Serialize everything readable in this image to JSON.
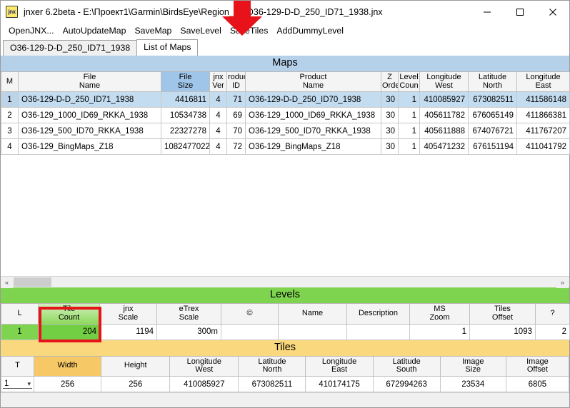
{
  "window": {
    "icon_label": "jnx",
    "title": "jnxer 6.2beta - E:\\Проект1\\Garmin\\BirdsEye\\Region_69\\O36-129-D-D_250_ID71_1938.jnx",
    "minimize_label": "minimize-icon",
    "maximize_label": "maximize-icon",
    "close_label": "close-icon"
  },
  "menu": {
    "items": [
      {
        "label": "OpenJNX..."
      },
      {
        "label": "AutoUpdateMap"
      },
      {
        "label": "SaveMap"
      },
      {
        "label": "SaveLevel"
      },
      {
        "label": "SaveTiles"
      },
      {
        "label": "AddDummyLevel"
      }
    ]
  },
  "tabs": [
    {
      "label": "O36-129-D-D_250_ID71_1938",
      "active": false
    },
    {
      "label": "List of Maps",
      "active": true
    }
  ],
  "maps": {
    "title": "Maps",
    "headers": [
      "M",
      "File\nName",
      "File\nSize",
      "jnx\nVer",
      "roduc\nID",
      "Product\nName",
      "Z\nOrde",
      "Level\nCoun",
      "Longitude\nWest",
      "Latitude\nNorth",
      "Longitude\nEast"
    ],
    "header_lines": [
      [
        "M",
        ""
      ],
      [
        "File",
        "Name"
      ],
      [
        "File",
        "Size"
      ],
      [
        "jnx",
        "Ver"
      ],
      [
        "roduc",
        "ID"
      ],
      [
        "Product",
        "Name"
      ],
      [
        "Z",
        "Orde"
      ],
      [
        "Level",
        "Coun"
      ],
      [
        "Longitude",
        "West"
      ],
      [
        "Latitude",
        "North"
      ],
      [
        "Longitude",
        "East"
      ]
    ],
    "rows": [
      {
        "m": "1",
        "file_name": "O36-129-D-D_250_ID71_1938",
        "file_size": "4416811",
        "jnx_ver": "4",
        "product_id": "71",
        "product_name": "O36-129-D-D_250_ID70_1938",
        "z_order": "30",
        "level_count": "1",
        "longitude_west": "410085927",
        "latitude_north": "673082511",
        "longitude_east": "411586148",
        "selected": true
      },
      {
        "m": "2",
        "file_name": "O36-129_1000_ID69_RKKA_1938",
        "file_size": "10534738",
        "jnx_ver": "4",
        "product_id": "69",
        "product_name": "O36-129_1000_ID69_RKKA_1938",
        "z_order": "30",
        "level_count": "1",
        "longitude_west": "405611782",
        "latitude_north": "676065149",
        "longitude_east": "411866381",
        "selected": false
      },
      {
        "m": "3",
        "file_name": "O36-129_500_ID70_RKKA_1938",
        "file_size": "22327278",
        "jnx_ver": "4",
        "product_id": "70",
        "product_name": "O36-129_500_ID70_RKKA_1938",
        "z_order": "30",
        "level_count": "1",
        "longitude_west": "405611888",
        "latitude_north": "674076721",
        "longitude_east": "411767207",
        "selected": false
      },
      {
        "m": "4",
        "file_name": "O36-129_BingMaps_Z18",
        "file_size": "1082477022",
        "jnx_ver": "4",
        "product_id": "72",
        "product_name": "O36-129_BingMaps_Z18",
        "z_order": "30",
        "level_count": "1",
        "longitude_west": "405471232",
        "latitude_north": "676151194",
        "longitude_east": "411041792",
        "selected": false
      }
    ]
  },
  "levels": {
    "title": "Levels",
    "header_lines": [
      [
        "L",
        ""
      ],
      [
        "Tile",
        "Count"
      ],
      [
        "jnx",
        "Scale"
      ],
      [
        "eTrex",
        "Scale"
      ],
      [
        "©",
        ""
      ],
      [
        "Name",
        ""
      ],
      [
        "Description",
        ""
      ],
      [
        "MS",
        "Zoom"
      ],
      [
        "Tiles",
        "Offset"
      ],
      [
        "?",
        ""
      ]
    ],
    "rows": [
      {
        "l": "1",
        "tile_count": "204",
        "jnx_scale": "1194",
        "etrex_scale": "300m",
        "copyright": "",
        "name": "",
        "description": "",
        "ms_zoom": "1",
        "tiles_offset": "1093",
        "unknown": "2"
      }
    ]
  },
  "tiles": {
    "title": "Tiles",
    "header_lines": [
      [
        "T",
        ""
      ],
      [
        "Width",
        ""
      ],
      [
        "Height",
        ""
      ],
      [
        "Longitude",
        "West"
      ],
      [
        "Latitude",
        "North"
      ],
      [
        "Longitude",
        "East"
      ],
      [
        "Latitude",
        "South"
      ],
      [
        "Image",
        "Size"
      ],
      [
        "Image",
        "Offset"
      ]
    ],
    "rows": [
      {
        "t": "1",
        "width": "256",
        "height": "256",
        "longitude_west": "410085927",
        "latitude_north": "673082511",
        "longitude_east": "410174175",
        "latitude_south": "672994263",
        "image_size": "23534",
        "image_offset": "6805"
      }
    ]
  },
  "scrollbar": {
    "left_arrow": "«",
    "right_arrow": "»"
  },
  "annotations": {
    "arrow": {
      "points_to": "SaveTiles",
      "color": "#e8121b"
    },
    "rect": {
      "highlights": "Tile Count",
      "color": "#e8121b"
    }
  },
  "colors": {
    "maps_header": "#b5d1ea",
    "levels_header": "#7fd44f",
    "tiles_header": "#fad87d",
    "selection": "#c4dcf0",
    "annotation": "#e8121b"
  }
}
